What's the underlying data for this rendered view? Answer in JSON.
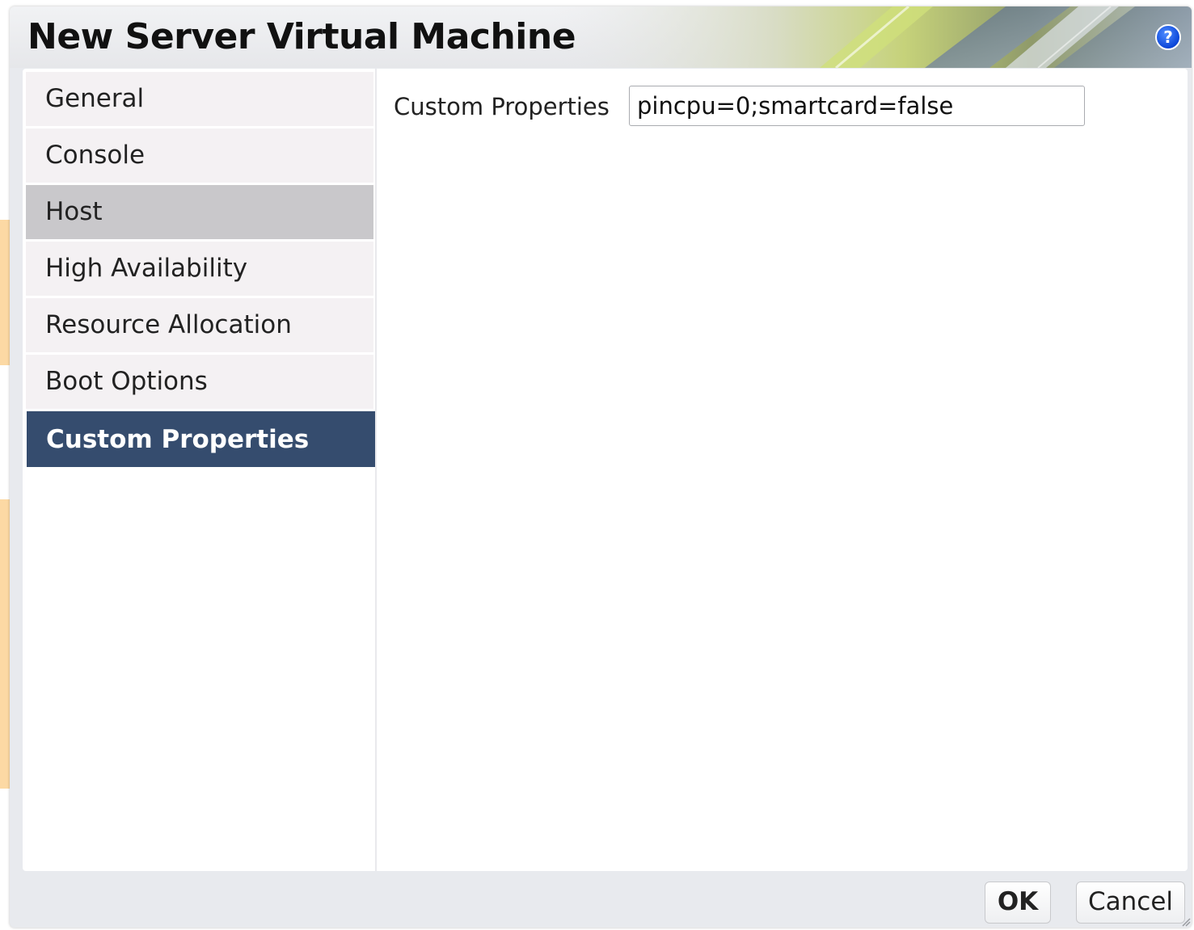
{
  "dialog": {
    "title": "New Server Virtual Machine",
    "help_icon": "help-icon",
    "help_glyph": "?"
  },
  "nav": {
    "items": [
      {
        "label": "General",
        "state": "normal"
      },
      {
        "label": "Console",
        "state": "normal"
      },
      {
        "label": "Host",
        "state": "hover"
      },
      {
        "label": "High Availability",
        "state": "normal"
      },
      {
        "label": "Resource Allocation",
        "state": "normal"
      },
      {
        "label": "Boot Options",
        "state": "normal"
      },
      {
        "label": "Custom Properties",
        "state": "selected"
      }
    ]
  },
  "main": {
    "custom_properties_label": "Custom Properties",
    "custom_properties_value": "pincpu=0;smartcard=false"
  },
  "footer": {
    "ok_label": "OK",
    "cancel_label": "Cancel"
  },
  "colors": {
    "selected_nav_bg": "#354c6e",
    "hover_nav_bg": "#c9c8cb",
    "nav_bg": "#f4f1f3",
    "help_icon": "#0b46d8",
    "dialog_frame": "#e8eaee"
  }
}
